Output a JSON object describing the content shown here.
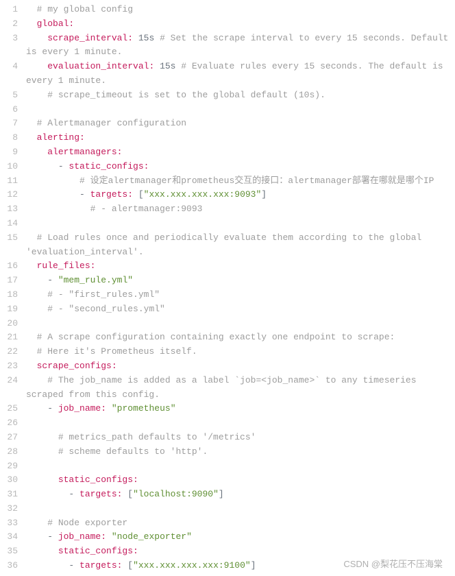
{
  "watermark": "CSDN @梨花压不压海棠",
  "lines": [
    {
      "n": "1",
      "indent": "  ",
      "segs": [
        {
          "c": "comment",
          "t": "# my global config"
        }
      ]
    },
    {
      "n": "2",
      "indent": "  ",
      "segs": [
        {
          "c": "key",
          "t": "global"
        },
        {
          "c": "key",
          "t": ":"
        }
      ]
    },
    {
      "n": "3",
      "indent": "    ",
      "segs": [
        {
          "c": "key",
          "t": "scrape_interval"
        },
        {
          "c": "key",
          "t": ":"
        },
        {
          "c": "",
          "t": " 15s "
        },
        {
          "c": "comment",
          "t": "# Set the scrape interval to every 15 seconds. Default is every 1 minute."
        }
      ]
    },
    {
      "n": "4",
      "indent": "    ",
      "segs": [
        {
          "c": "key",
          "t": "evaluation_interval"
        },
        {
          "c": "key",
          "t": ":"
        },
        {
          "c": "",
          "t": " 15s "
        },
        {
          "c": "comment",
          "t": "# Evaluate rules every 15 seconds. The default is every 1 minute."
        }
      ]
    },
    {
      "n": "5",
      "indent": "    ",
      "segs": [
        {
          "c": "comment",
          "t": "# scrape_timeout is set to the global default (10s)."
        }
      ]
    },
    {
      "n": "6",
      "indent": "",
      "segs": []
    },
    {
      "n": "7",
      "indent": "  ",
      "segs": [
        {
          "c": "comment",
          "t": "# Alertmanager configuration"
        }
      ]
    },
    {
      "n": "8",
      "indent": "  ",
      "segs": [
        {
          "c": "key",
          "t": "alerting"
        },
        {
          "c": "key",
          "t": ":"
        }
      ]
    },
    {
      "n": "9",
      "indent": "    ",
      "segs": [
        {
          "c": "key",
          "t": "alertmanagers"
        },
        {
          "c": "key",
          "t": ":"
        }
      ]
    },
    {
      "n": "10",
      "indent": "      ",
      "segs": [
        {
          "c": "",
          "t": "- "
        },
        {
          "c": "key",
          "t": "static_configs"
        },
        {
          "c": "key",
          "t": ":"
        }
      ]
    },
    {
      "n": "11",
      "indent": "          ",
      "segs": [
        {
          "c": "comment",
          "t": "# 设定alertmanager和prometheus交互的接口：alertmanager部署在哪就是哪个IP"
        }
      ]
    },
    {
      "n": "12",
      "indent": "          ",
      "segs": [
        {
          "c": "",
          "t": "- "
        },
        {
          "c": "key",
          "t": "targets"
        },
        {
          "c": "key",
          "t": ":"
        },
        {
          "c": "",
          "t": " ["
        },
        {
          "c": "string",
          "t": "\"xxx.xxx.xxx.xxx:9093\""
        },
        {
          "c": "",
          "t": "]"
        }
      ]
    },
    {
      "n": "13",
      "indent": "            ",
      "segs": [
        {
          "c": "comment",
          "t": "# - alertmanager:9093"
        }
      ]
    },
    {
      "n": "14",
      "indent": "",
      "segs": []
    },
    {
      "n": "15",
      "indent": "  ",
      "segs": [
        {
          "c": "comment",
          "t": "# Load rules once and periodically evaluate them according to the global 'evaluation_interval'."
        }
      ]
    },
    {
      "n": "16",
      "indent": "  ",
      "segs": [
        {
          "c": "key",
          "t": "rule_files"
        },
        {
          "c": "key",
          "t": ":"
        }
      ]
    },
    {
      "n": "17",
      "indent": "    ",
      "segs": [
        {
          "c": "",
          "t": "- "
        },
        {
          "c": "string",
          "t": "\"mem_rule.yml\""
        }
      ]
    },
    {
      "n": "18",
      "indent": "    ",
      "segs": [
        {
          "c": "comment",
          "t": "# - \"first_rules.yml\""
        }
      ]
    },
    {
      "n": "19",
      "indent": "    ",
      "segs": [
        {
          "c": "comment",
          "t": "# - \"second_rules.yml\""
        }
      ]
    },
    {
      "n": "20",
      "indent": "",
      "segs": []
    },
    {
      "n": "21",
      "indent": "  ",
      "segs": [
        {
          "c": "comment",
          "t": "# A scrape configuration containing exactly one endpoint to scrape:"
        }
      ]
    },
    {
      "n": "22",
      "indent": "  ",
      "segs": [
        {
          "c": "comment",
          "t": "# Here it's Prometheus itself."
        }
      ]
    },
    {
      "n": "23",
      "indent": "  ",
      "segs": [
        {
          "c": "key",
          "t": "scrape_configs"
        },
        {
          "c": "key",
          "t": ":"
        }
      ]
    },
    {
      "n": "24",
      "indent": "    ",
      "segs": [
        {
          "c": "comment",
          "t": "# The job_name is added as a label `job=<job_name>` to any timeseries scraped from this config."
        }
      ]
    },
    {
      "n": "25",
      "indent": "    ",
      "segs": [
        {
          "c": "",
          "t": "- "
        },
        {
          "c": "key",
          "t": "job_name"
        },
        {
          "c": "key",
          "t": ":"
        },
        {
          "c": "",
          "t": " "
        },
        {
          "c": "string",
          "t": "\"prometheus\""
        }
      ]
    },
    {
      "n": "26",
      "indent": "",
      "segs": []
    },
    {
      "n": "27",
      "indent": "      ",
      "segs": [
        {
          "c": "comment",
          "t": "# metrics_path defaults to '/metrics'"
        }
      ]
    },
    {
      "n": "28",
      "indent": "      ",
      "segs": [
        {
          "c": "comment",
          "t": "# scheme defaults to 'http'."
        }
      ]
    },
    {
      "n": "29",
      "indent": "",
      "segs": []
    },
    {
      "n": "30",
      "indent": "      ",
      "segs": [
        {
          "c": "key",
          "t": "static_configs"
        },
        {
          "c": "key",
          "t": ":"
        }
      ]
    },
    {
      "n": "31",
      "indent": "        ",
      "segs": [
        {
          "c": "",
          "t": "- "
        },
        {
          "c": "key",
          "t": "targets"
        },
        {
          "c": "key",
          "t": ":"
        },
        {
          "c": "",
          "t": " ["
        },
        {
          "c": "string",
          "t": "\"localhost:9090\""
        },
        {
          "c": "",
          "t": "]"
        }
      ]
    },
    {
      "n": "32",
      "indent": "",
      "segs": []
    },
    {
      "n": "33",
      "indent": "    ",
      "segs": [
        {
          "c": "comment",
          "t": "# Node exporter"
        }
      ]
    },
    {
      "n": "34",
      "indent": "    ",
      "segs": [
        {
          "c": "",
          "t": "- "
        },
        {
          "c": "key",
          "t": "job_name"
        },
        {
          "c": "key",
          "t": ":"
        },
        {
          "c": "",
          "t": " "
        },
        {
          "c": "string",
          "t": "\"node_exporter\""
        }
      ]
    },
    {
      "n": "35",
      "indent": "      ",
      "segs": [
        {
          "c": "key",
          "t": "static_configs"
        },
        {
          "c": "key",
          "t": ":"
        }
      ]
    },
    {
      "n": "36",
      "indent": "        ",
      "segs": [
        {
          "c": "",
          "t": "- "
        },
        {
          "c": "key",
          "t": "targets"
        },
        {
          "c": "key",
          "t": ":"
        },
        {
          "c": "",
          "t": " ["
        },
        {
          "c": "string",
          "t": "\"xxx.xxx.xxx.xxx:9100\""
        },
        {
          "c": "",
          "t": "]"
        }
      ]
    }
  ]
}
